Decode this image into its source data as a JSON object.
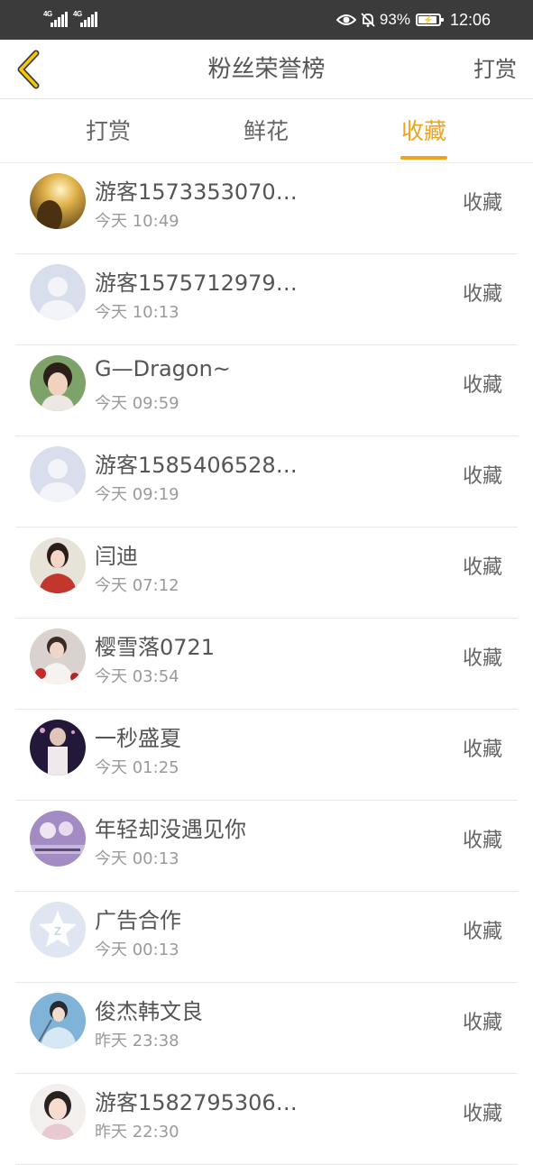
{
  "status_bar": {
    "network_1": "4G",
    "network_2": "4G",
    "battery_text": "93%",
    "battery_level": 0.93,
    "time": "12:06",
    "icons": [
      "eye-icon",
      "bell-off-icon",
      "battery-charging-icon"
    ]
  },
  "nav": {
    "title": "粉丝荣誉榜",
    "action": "打赏",
    "back_icon": "chevron-left-icon"
  },
  "tabs": [
    {
      "label": "打赏",
      "active": false
    },
    {
      "label": "鲜花",
      "active": false
    },
    {
      "label": "收藏",
      "active": true
    }
  ],
  "colors": {
    "accent": "#f0a31c",
    "status_bar_bg": "#3b3b3b"
  },
  "fans": [
    {
      "name": "游客1573353070…",
      "time": "今天 10:49",
      "action": "收藏",
      "avatar": "sunset-photo"
    },
    {
      "name": "游客1575712979…",
      "time": "今天 10:13",
      "action": "收藏",
      "avatar": "default-user"
    },
    {
      "name": "G—Dragon~",
      "time": "今天 09:59",
      "action": "收藏",
      "avatar": "girl-photo"
    },
    {
      "name": "游客1585406528…",
      "time": "今天 09:19",
      "action": "收藏",
      "avatar": "default-user"
    },
    {
      "name": "闫迪",
      "time": "今天 07:12",
      "action": "收藏",
      "avatar": "woman-red-dress"
    },
    {
      "name": "樱雪落0721",
      "time": "今天 03:54",
      "action": "收藏",
      "avatar": "boy-with-roses"
    },
    {
      "name": "一秒盛夏",
      "time": "今天 01:25",
      "action": "收藏",
      "avatar": "man-dark-background"
    },
    {
      "name": "年轻却没遇见你",
      "time": "今天 00:13",
      "action": "收藏",
      "avatar": "purple-group-photo"
    },
    {
      "name": "广告合作",
      "time": "今天 00:13",
      "action": "收藏",
      "avatar": "qzone-star-logo"
    },
    {
      "name": "俊杰韩文良",
      "time": "昨天 23:38",
      "action": "收藏",
      "avatar": "costume-man-photo"
    },
    {
      "name": "游客1582795306…",
      "time": "昨天 22:30",
      "action": "收藏",
      "avatar": "girl-smiling-photo"
    }
  ]
}
